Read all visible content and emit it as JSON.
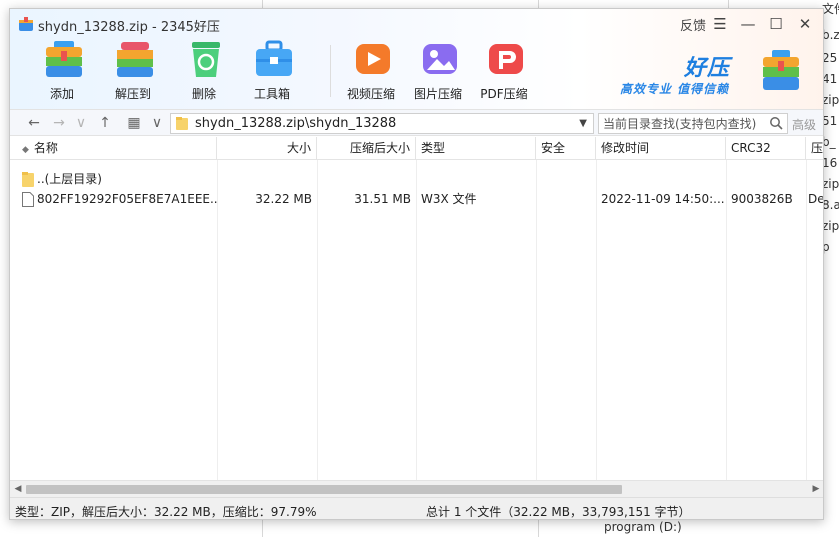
{
  "window": {
    "title": "shydn_13288.zip - 2345好压",
    "feedback_label": "反馈",
    "menu_icon": "hamburger-icon",
    "minimize_icon": "minimize-icon",
    "maximize_icon": "maximize-icon",
    "close_icon": "close-icon"
  },
  "toolbar": {
    "buttons": [
      {
        "label": "添加",
        "icon": "add-archive-icon"
      },
      {
        "label": "解压到",
        "icon": "extract-icon"
      },
      {
        "label": "删除",
        "icon": "delete-recycle-icon"
      },
      {
        "label": "工具箱",
        "icon": "toolbox-icon"
      },
      {
        "label": "视频压缩",
        "icon": "video-compress-icon"
      },
      {
        "label": "图片压缩",
        "icon": "image-compress-icon"
      },
      {
        "label": "PDF压缩",
        "icon": "pdf-compress-icon"
      }
    ],
    "brand_name": "好压",
    "brand_tagline": "高效专业  值得信赖"
  },
  "addressbar": {
    "path": "shydn_13288.zip\\shydn_13288",
    "search_placeholder": "当前目录查找(支持包内查找)",
    "advanced_search": "高级"
  },
  "columns": [
    "名称",
    "大小",
    "压缩后大小",
    "类型",
    "安全",
    "修改时间",
    "CRC32",
    "压"
  ],
  "rows": [
    {
      "name": "..(上层目录)",
      "size": "",
      "packed": "",
      "type": "",
      "security": "",
      "modified": "",
      "crc": "",
      "method": "",
      "icon": "folder-icon"
    },
    {
      "name": "802FF19292F05EF8E7A1EEE...",
      "size": "32.22 MB",
      "packed": "31.51 MB",
      "type": "W3X 文件",
      "security": "",
      "modified": "2022-11-09 14:50:...",
      "crc": "9003826B",
      "method": "De",
      "icon": "file-icon"
    }
  ],
  "statusbar": {
    "left": "类型：ZIP，解压后大小：32.22 MB，压缩比：97.79%",
    "right": "总计 1 个文件（32.22 MB，33,793,151 字节）"
  },
  "background": {
    "right_fragments": [
      "文件",
      "b.zip",
      "25",
      "41",
      "zip",
      "51",
      "b_",
      "16",
      "zip",
      "8.a",
      "zip",
      "p"
    ],
    "bottom_text": "program (D:)"
  },
  "colors": {
    "brand_blue": "#1e7fe0",
    "scroll_thumb": "#c2c2c2"
  }
}
